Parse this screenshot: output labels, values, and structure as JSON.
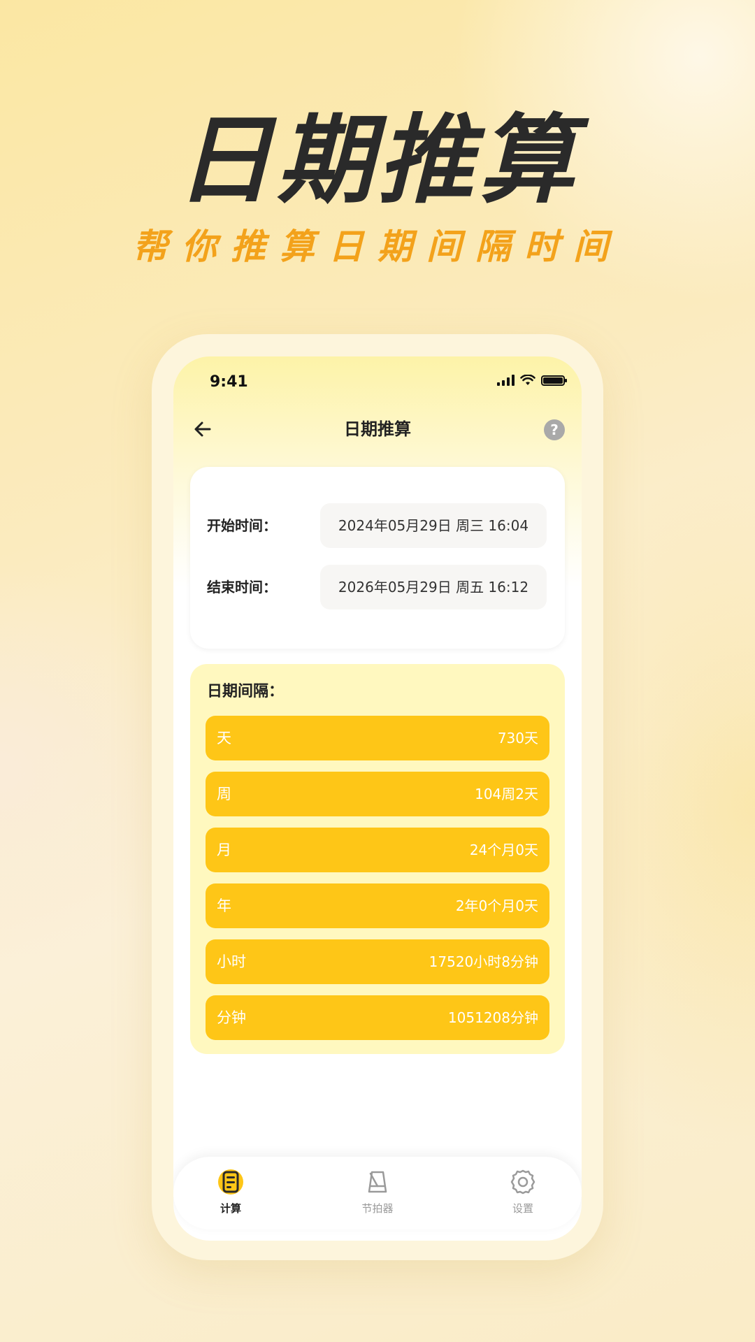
{
  "promo": {
    "headline": "日期推算",
    "subline": "帮你推算日期间隔时间"
  },
  "status_bar": {
    "time": "9:41",
    "icons": [
      "signal-icon",
      "wifi-icon",
      "battery-icon"
    ]
  },
  "nav": {
    "back_icon": "arrow-left-icon",
    "title": "日期推算",
    "help_label": "?"
  },
  "time_card": {
    "start_label": "开始时间：",
    "start_value": "2024年05月29日 周三 16:04",
    "end_label": "结束时间：",
    "end_value": "2026年05月29日 周五 16:12"
  },
  "interval": {
    "title": "日期间隔：",
    "rows": [
      {
        "label": "天",
        "value": "730天"
      },
      {
        "label": "周",
        "value": "104周2天"
      },
      {
        "label": "月",
        "value": "24个月0天"
      },
      {
        "label": "年",
        "value": "2年0个月0天"
      },
      {
        "label": "小时",
        "value": "17520小时8分钟"
      },
      {
        "label": "分钟",
        "value": "1051208分钟"
      }
    ]
  },
  "tab_bar": {
    "tabs": [
      {
        "label": "计算",
        "icon": "calculator-icon",
        "active": true
      },
      {
        "label": "节拍器",
        "icon": "metronome-icon",
        "active": false
      },
      {
        "label": "设置",
        "icon": "gear-icon",
        "active": false
      }
    ]
  },
  "colors": {
    "accent": "#fec617",
    "subline": "#f3a21b",
    "text_dark": "#222222",
    "tab_inactive": "#9a9a9a"
  }
}
